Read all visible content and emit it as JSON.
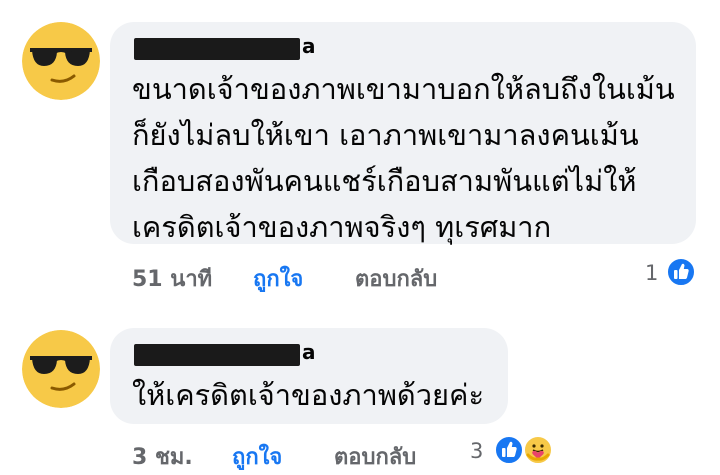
{
  "comments": [
    {
      "name_suffix": "a",
      "text": "ขนาดเจ้าของภาพเขามาบอกให้ลบถึงในเม้น\nก็ยังไม่ลบให้เขา เอาภาพเขามาลงคนเม้น\nเกือบสองพันคนแชร์เกือบสามพันแต่ไม่ให้\nเครดิตเจ้าของภาพจริงๆ ทุเรศมาก",
      "time": "51 นาที",
      "like_label": "ถูกใจ",
      "reply_label": "ตอบกลับ",
      "reaction_count": "1",
      "reactions": [
        "like-icon"
      ]
    },
    {
      "name_suffix": "a",
      "text": "ให้เครดิตเจ้าของภาพด้วยค่ะ",
      "time": "3 ชม.",
      "like_label": "ถูกใจ",
      "reply_label": "ตอบกลับ",
      "reaction_count": "3",
      "reactions": [
        "like-icon",
        "care-icon"
      ]
    }
  ],
  "colors": {
    "bubble": "#f0f2f5",
    "like_blue": "#1877f2",
    "meta_gray": "#65676b",
    "emoji_yellow": "#f7c948"
  }
}
